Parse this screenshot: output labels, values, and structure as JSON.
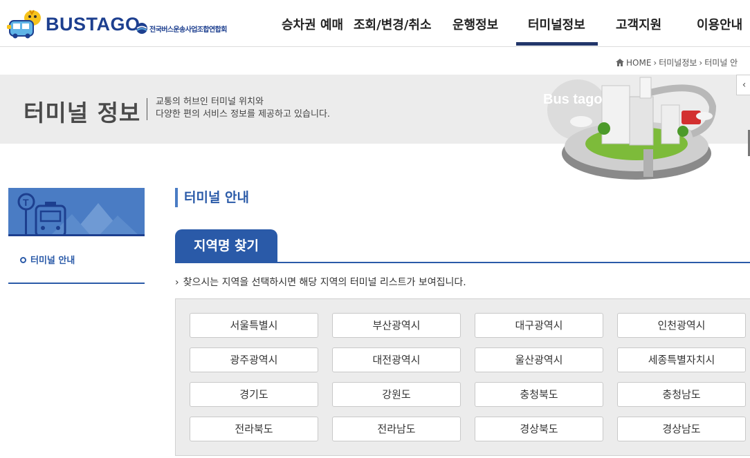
{
  "header": {
    "logo_text": "BUSTAGO",
    "org_text": "전국버스운송사업조합연합회",
    "nav": [
      {
        "label": "승차권 예매"
      },
      {
        "label": "조회/변경/취소"
      },
      {
        "label": "운행정보"
      },
      {
        "label": "터미널정보",
        "active": true
      },
      {
        "label": "고객지원"
      },
      {
        "label": "이용안내"
      }
    ]
  },
  "breadcrumb": [
    "HOME",
    "터미널정보",
    "터미널 안"
  ],
  "banner": {
    "title": "터미널 정보",
    "desc_line1": "교통의 허브인 터미널 위치와",
    "desc_line2": "다양한 편의 서비스 정보를 제공하고 있습니다.",
    "brand": "Bus tago"
  },
  "sidebar": {
    "items": [
      {
        "label": "터미널 안내"
      }
    ]
  },
  "main": {
    "section_title": "터미널 안내",
    "tab_label": "지역명 찾기",
    "hint": "찾으시는 지역을 선택하시면 해당 지역의 터미널 리스트가 보여집니다.",
    "regions": [
      "서울특별시",
      "부산광역시",
      "대구광역시",
      "인천광역시",
      "광주광역시",
      "대전광역시",
      "울산광역시",
      "세종특별자치시",
      "경기도",
      "강원도",
      "충청북도",
      "충청남도",
      "전라북도",
      "전라남도",
      "경상북도",
      "경상남도"
    ]
  },
  "colors": {
    "brand_navy": "#1d3f8f",
    "accent_blue": "#2a5aa8",
    "banner_gray": "#ececec"
  }
}
